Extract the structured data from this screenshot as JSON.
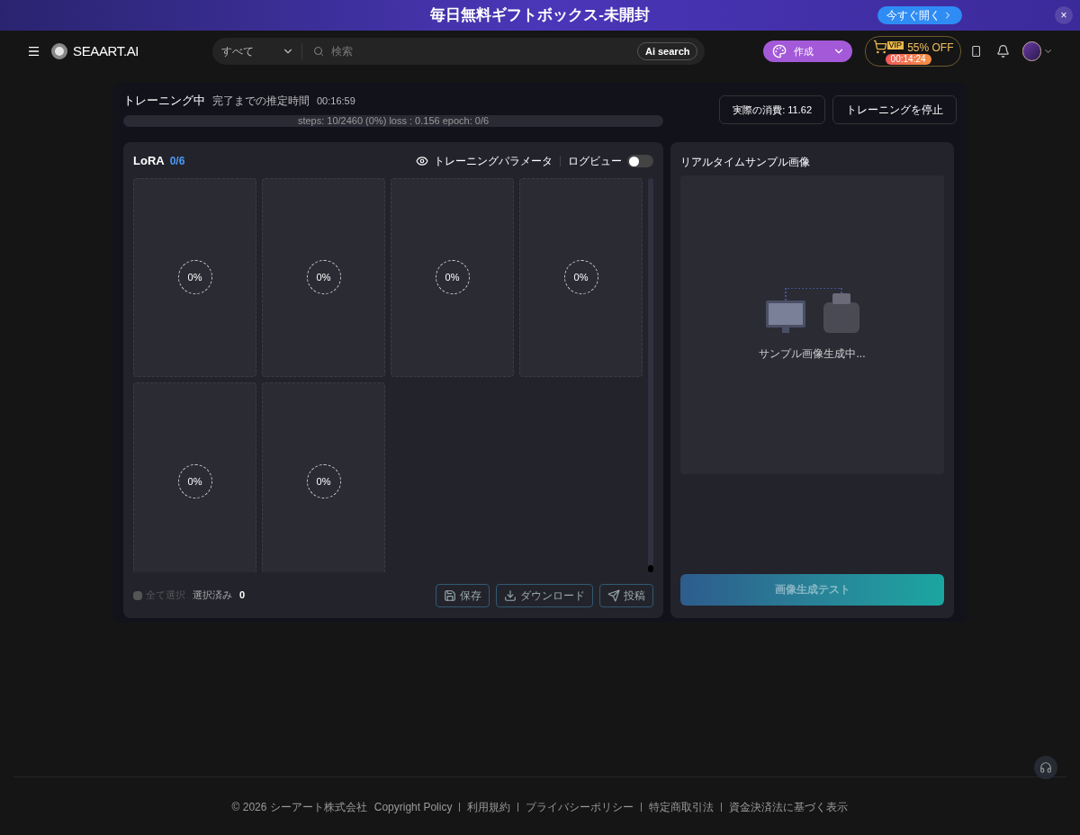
{
  "banner": {
    "title": "毎日無料ギフトボックス-未開封",
    "cta": "今すぐ開く",
    "close": "×"
  },
  "header": {
    "logo": "SEAART.AI",
    "search_scope": "すべて",
    "search_placeholder": "検索",
    "ai_search": "Ai search",
    "create": "作成",
    "promo": {
      "badge": "VIP",
      "label": "55% OFF",
      "timer": "00:14:24"
    }
  },
  "training": {
    "status": "トレーニング中",
    "eta_label": "完了までの推定時間",
    "eta": "00:16:59",
    "progress": {
      "level": 0.0,
      "text": "steps: 10/2460 (0%) loss : 0.156 epoch: 0/6"
    },
    "cost": "実際の消費: 11.62",
    "stop": "トレーニングを停止"
  },
  "lora": {
    "title": "LoRA",
    "count": "0/6",
    "params": "トレーニングパラメータ",
    "log_view": {
      "label": "ログビュー",
      "on": false
    },
    "tiles": [
      {
        "progress": "0%"
      },
      {
        "progress": "0%"
      },
      {
        "progress": "0%"
      },
      {
        "progress": "0%"
      },
      {
        "progress": "0%"
      },
      {
        "progress": "0%"
      }
    ],
    "select_all": {
      "label": "全て選択",
      "checked": false,
      "disabled": true
    },
    "selected_label": "選択済み",
    "selected_count": "0",
    "actions": [
      {
        "kind": "save",
        "label": "保存"
      },
      {
        "kind": "download",
        "label": "ダウンロード"
      },
      {
        "kind": "post",
        "label": "投稿"
      }
    ]
  },
  "sample": {
    "title": "リアルタイムサンプル画像",
    "status": "サンプル画像生成中...",
    "test_button": {
      "label": "画像生成テスト",
      "disabled": true
    }
  },
  "footer": {
    "copyright": "© 2026 シーアート株式会社",
    "links": [
      "Copyright Policy",
      "利用規約",
      "プライバシーポリシー",
      "特定商取引法",
      "資金決済法に基づく表示"
    ]
  }
}
